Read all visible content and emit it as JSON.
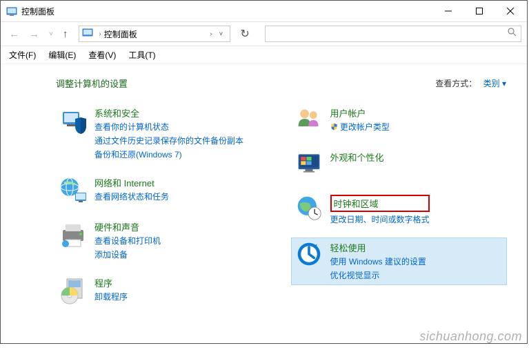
{
  "window": {
    "title": "控制面板"
  },
  "breadcrumb": {
    "root": "控制面板"
  },
  "menu": {
    "file": "文件(F)",
    "edit": "编辑(E)",
    "view": "查看(V)",
    "tools": "工具(T)"
  },
  "heading": "调整计算机的设置",
  "viewBy": {
    "label": "查看方式：",
    "value": "类别"
  },
  "categories": {
    "left": [
      {
        "title": "系统和安全",
        "links": [
          "查看你的计算机状态",
          "通过文件历史记录保存你的文件备份副本",
          "备份和还原(Windows 7)"
        ]
      },
      {
        "title": "网络和 Internet",
        "links": [
          "查看网络状态和任务"
        ]
      },
      {
        "title": "硬件和声音",
        "links": [
          "查看设备和打印机",
          "添加设备"
        ]
      },
      {
        "title": "程序",
        "links": [
          "卸载程序"
        ]
      }
    ],
    "right": [
      {
        "title": "用户帐户",
        "links": [
          "更改帐户类型"
        ]
      },
      {
        "title": "外观和个性化",
        "links": []
      },
      {
        "title": "时钟和区域",
        "links": [
          "更改日期、时间或数字格式"
        ]
      },
      {
        "title": "轻松使用",
        "links": [
          "使用 Windows 建议的设置",
          "优化视觉显示"
        ]
      }
    ]
  },
  "watermark": "sichuanhong.com"
}
